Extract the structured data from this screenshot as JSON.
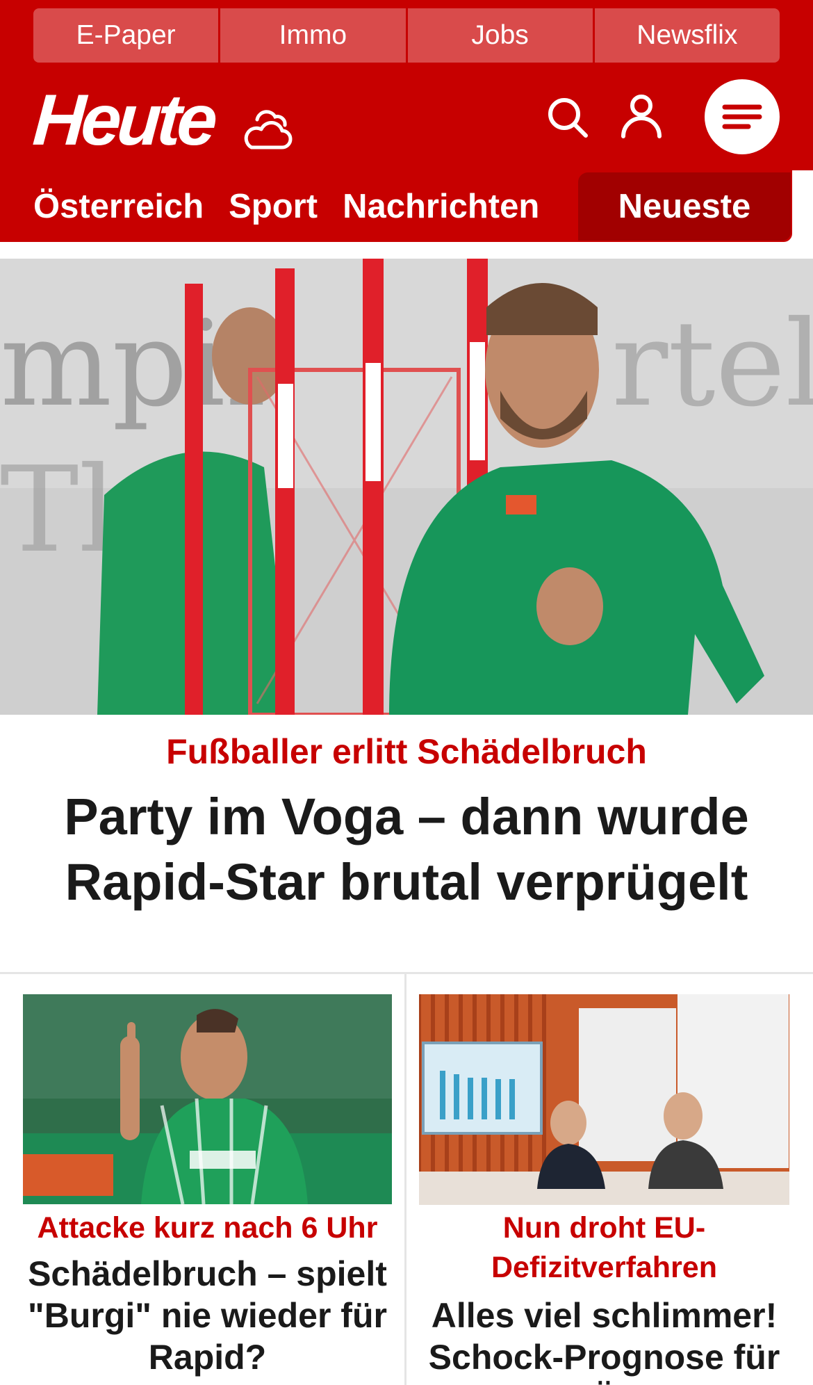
{
  "colors": {
    "brand_red": "#c70000",
    "active_tab": "#a10000",
    "link_tab": "#d94b4b",
    "text": "#1a1a1a"
  },
  "top_links": [
    "E-Paper",
    "Immo",
    "Jobs",
    "Newsflix"
  ],
  "header": {
    "logo_text": "Heute",
    "icons": [
      "weather-cloud-icon",
      "search-icon",
      "user-icon",
      "menu-icon"
    ]
  },
  "nav": {
    "items": [
      "Österreich",
      "Sport",
      "Nachrichten"
    ],
    "active_item": "Neueste"
  },
  "hero": {
    "kicker": "Fußballer erlitt Schädelbruch",
    "title": "Party im Voga – dann wurde Rapid-Star brutal verprügelt"
  },
  "cards": [
    {
      "kicker": "Attacke kurz nach 6 Uhr",
      "title": "Schädelbruch – spielt \"Burgi\" nie wieder für Rapid?"
    },
    {
      "kicker": "Nun droht EU-Defizitverfahren",
      "title": "Alles viel schlimmer! Schock-Prognose für Ö"
    }
  ]
}
